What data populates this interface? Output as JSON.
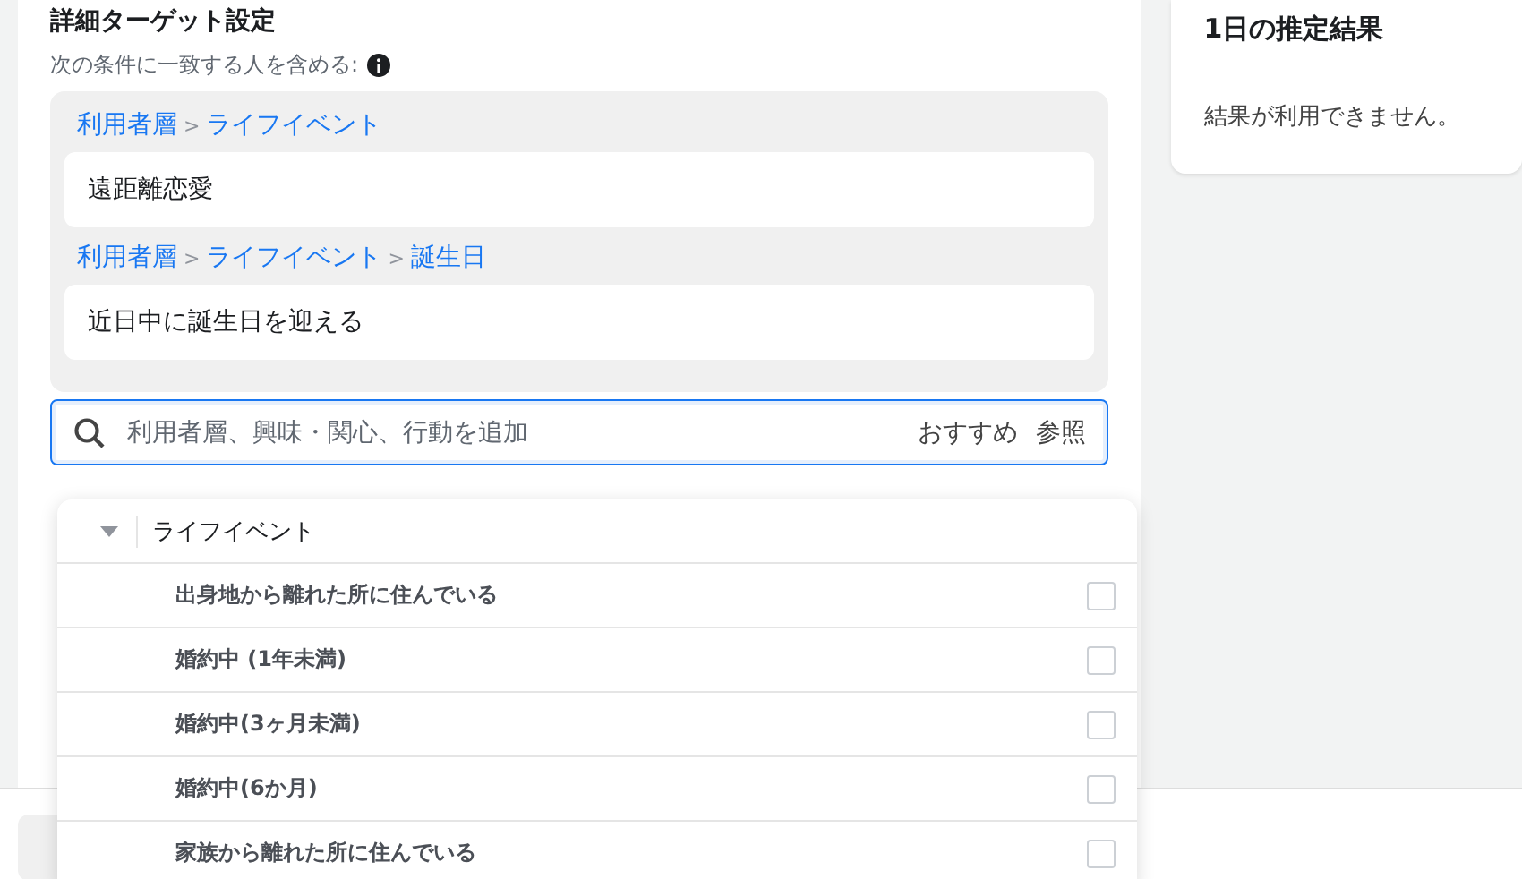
{
  "targeting": {
    "title": "詳細ターゲット設定",
    "subtitle": "次の条件に一致する人を含める:",
    "separator": ">",
    "groups": [
      {
        "path": [
          "利用者層",
          "ライフイベント"
        ],
        "item": "遠距離恋愛"
      },
      {
        "path": [
          "利用者層",
          "ライフイベント",
          "誕生日"
        ],
        "item": "近日中に誕生日を迎える"
      }
    ],
    "search": {
      "placeholder": "利用者層、興味・関心、行動を追加",
      "links": [
        "おすすめ",
        "参照"
      ]
    },
    "dropdown": {
      "category": "ライフイベント",
      "expanded": true,
      "options": [
        {
          "label": "出身地から離れた所に住んでいる",
          "checked": false
        },
        {
          "label": "婚約中 (1年未満)",
          "checked": false
        },
        {
          "label": "婚約中(3ヶ月未満)",
          "checked": false
        },
        {
          "label": "婚約中(6か月)",
          "checked": false
        },
        {
          "label": "家族から離れた所に住んでいる",
          "checked": false
        }
      ]
    }
  },
  "estimate": {
    "title": "1日の推定結果",
    "message": "結果が利用できません。"
  }
}
